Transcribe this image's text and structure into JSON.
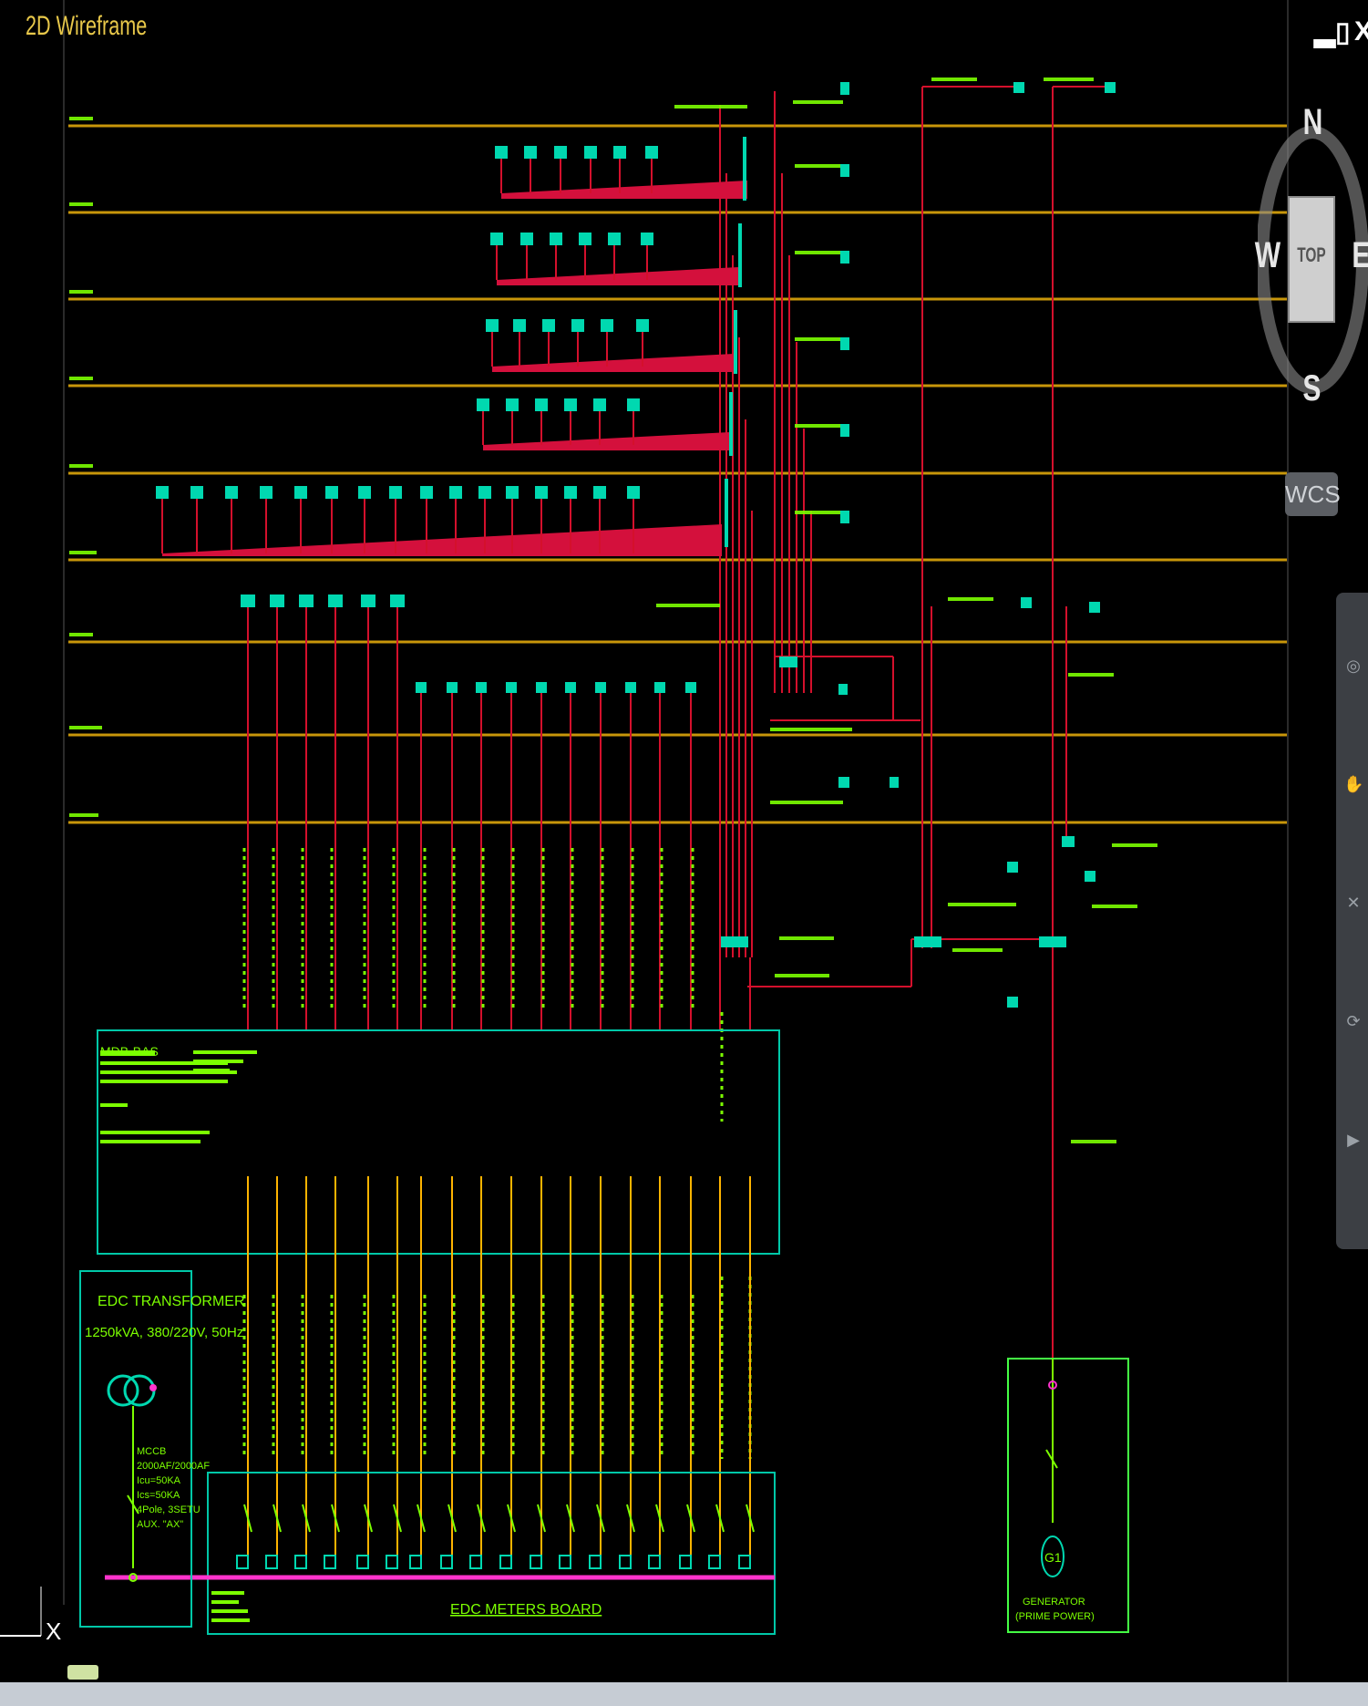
{
  "viewport": {
    "label": "2D Wireframe",
    "window_buttons": [
      "▂",
      "▯",
      "X"
    ]
  },
  "viewcube": {
    "north": "N",
    "south": "S",
    "east": "E",
    "west": "W",
    "face": "TOP",
    "ucs_menu": "WCS"
  },
  "transformer": {
    "title": "EDC TRANSFORMER",
    "rating": "1250kVA, 380/220V, 50Hz",
    "breaker_lines": [
      "MCCB",
      "2000AF/2000AF",
      "Icu=50KA",
      "Ics=50KA",
      "4Pole, 3SETU",
      "AUX. \"AX\""
    ]
  },
  "panels": {
    "mdb_title": "MDB-BAS",
    "meters_board": "EDC METERS BOARD",
    "generator_symbol": "G1",
    "generator_label": "GENERATOR",
    "generator_sub": "(PRIME POWER)"
  },
  "colors": {
    "floor_line": "#c8960a",
    "riser": "#d4102c",
    "equipment": "#00d8b0",
    "text": "#7cff00",
    "busbar": "#ff33cc",
    "panel_frame": "#00c8a8",
    "generator_frame": "#44ff44"
  }
}
